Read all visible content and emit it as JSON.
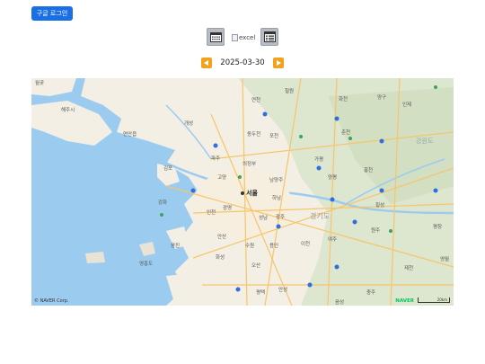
{
  "header": {
    "login_label": "구글 로그인"
  },
  "toolbar": {
    "calendar_icon": "calendar-icon",
    "excel_alt": "excel",
    "list_icon": "list-icon"
  },
  "date_nav": {
    "date": "2025-03-30",
    "prev_icon": "triangle-left-icon",
    "next_icon": "triangle-right-icon"
  },
  "map": {
    "labels": {
      "bucheon_w": "월곶",
      "yeoncheon": "연천",
      "cheolwon": "철원",
      "hwacheon": "화천",
      "yanggu": "양구",
      "inje": "인제",
      "gaeseong": "개성",
      "haeju": "해주시",
      "yeonan": "연안읍",
      "dongducheon": "동두천",
      "pocheon": "포천",
      "gapyeong": "가평",
      "chuncheon": "춘천",
      "gangwon": "강원도",
      "paju": "파주",
      "uijeongbu": "의정부",
      "namyangju": "남양주",
      "goyang": "고양",
      "seoul": "서울",
      "hanam": "하남",
      "yangpyeong": "양평",
      "hongcheon": "홍천",
      "gimpo": "김포",
      "incheon": "인천",
      "gwangmyeong": "광명",
      "seongnam": "성남",
      "gwangju": "광주",
      "gyeonggi": "경기도",
      "hoengseong": "횡성",
      "ansan": "안산",
      "suwon": "수원",
      "yongin": "용인",
      "icheon": "이천",
      "yeoju": "여주",
      "wonju": "원주",
      "pyeongchang": "평창",
      "ganghwa": "강화",
      "ongjin": "옹진",
      "hwaseong": "화성",
      "osan": "오산",
      "anseong": "안성",
      "pyeongtaek": "평택",
      "chungju": "충주",
      "jecheon": "제천",
      "yeongwol": "영월",
      "eumseong": "음성",
      "yeongheung": "영흥도"
    },
    "copyright": "© NAVER Corp.",
    "logo": "NAVER",
    "scale": "20km"
  },
  "colors": {
    "button_blue": "#1a6fe6",
    "arrow_orange": "#f1a31e",
    "sea": "#9ccbf0",
    "land": "#f3efe4",
    "forest": "#dfe8d0",
    "road": "#f6c56a"
  }
}
